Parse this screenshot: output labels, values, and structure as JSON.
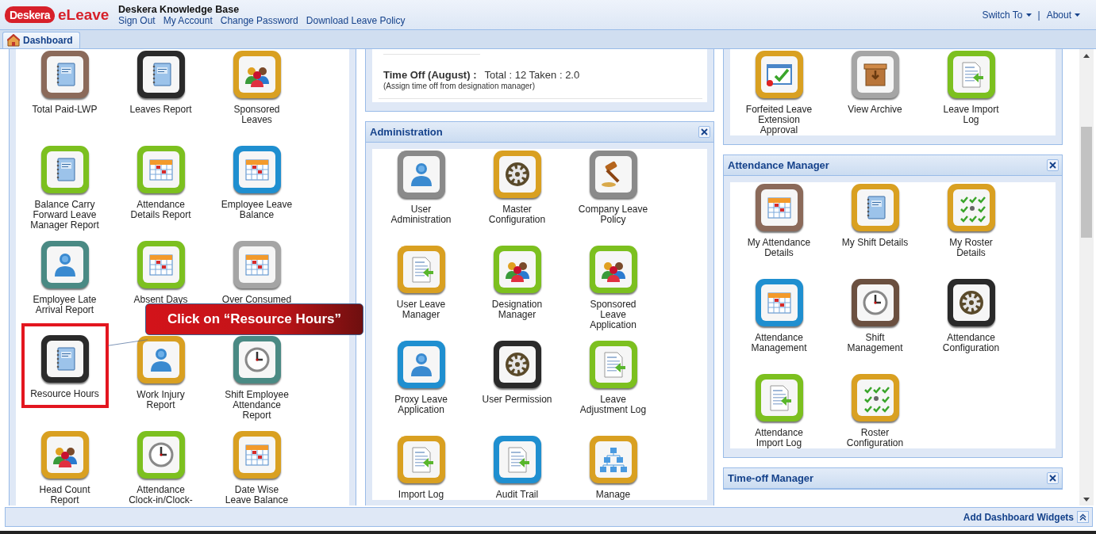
{
  "header": {
    "logo": {
      "mark": "Deskera",
      "product": "eLeave"
    },
    "site_title": "Deskera Knowledge Base",
    "links": [
      "Sign Out",
      "My Account",
      "Change Password",
      "Download Leave Policy"
    ],
    "menus": [
      {
        "label": "Switch To"
      },
      {
        "label": "About"
      }
    ],
    "separator": "|"
  },
  "tabs": [
    {
      "label": "Dashboard",
      "selected": true
    }
  ],
  "columns": [
    {
      "panels": [
        {
          "items": [
            {
              "label": "Total Paid-LWP",
              "kind": "notebook",
              "color": "#8b6a5a",
              "highlighted": false
            },
            {
              "label": "Leaves Report",
              "kind": "notebook",
              "color": "#2a2a2a",
              "highlighted": false
            },
            {
              "label": "Sponsored\nLeaves",
              "kind": "people",
              "color": "#d9a021",
              "highlighted": false
            },
            {
              "label": "Balance Carry\nForward Leave\nManager Report",
              "kind": "notebook",
              "color": "#7cc01f",
              "highlighted": false
            },
            {
              "label": "Attendance\nDetails Report",
              "kind": "calendar",
              "color": "#7cc01f",
              "highlighted": false
            },
            {
              "label": "Employee Leave\nBalance",
              "kind": "calendar",
              "color": "#1f8fd0",
              "highlighted": false
            },
            {
              "label": "Employee Late\nArrival Report",
              "kind": "person",
              "color": "#4a8a84",
              "highlighted": false
            },
            {
              "label": "Absent Days",
              "kind": "calendar",
              "color": "#7cc01f",
              "highlighted": false
            },
            {
              "label": "Over Consumed",
              "kind": "calendar",
              "color": "#a5a5a5",
              "highlighted": false
            },
            {
              "label": "Resource Hours",
              "kind": "notebook",
              "color": "#2a2a2a",
              "highlighted": true
            },
            {
              "label": "Work Injury\nReport",
              "kind": "person",
              "color": "#d9a021",
              "highlighted": false
            },
            {
              "label": "Shift Employee\nAttendance\nReport",
              "kind": "clock",
              "color": "#4a8a84",
              "highlighted": false
            },
            {
              "label": "Head Count\nReport",
              "kind": "people",
              "color": "#d9a021",
              "highlighted": false
            },
            {
              "label": "Attendance\nClock-in/Clock-",
              "kind": "clock",
              "color": "#7cc01f",
              "highlighted": false
            },
            {
              "label": "Date Wise\nLeave Balance",
              "kind": "calendar",
              "color": "#d9a021",
              "highlighted": false
            }
          ]
        }
      ]
    },
    {
      "panels": [
        {
          "info": {
            "heading": "Time Off (August) :",
            "value": "Total : 12 Taken : 2.0",
            "note": "(Assign time off from designation manager)"
          }
        },
        {
          "title": "Administration",
          "closable": true,
          "items": [
            {
              "label": "User\nAdministration",
              "kind": "person",
              "color": "#8a8a8a",
              "highlighted": false
            },
            {
              "label": "Master\nConfiguration",
              "kind": "gear",
              "color": "#d9a021",
              "highlighted": false
            },
            {
              "label": "Company Leave\nPolicy",
              "kind": "gavel",
              "color": "#8a8a8a",
              "highlighted": false
            },
            {
              "label": "User Leave\nManager",
              "kind": "document",
              "color": "#d9a021",
              "highlighted": false
            },
            {
              "label": "Designation\nManager",
              "kind": "people",
              "color": "#7cc01f",
              "highlighted": false
            },
            {
              "label": "Sponsored\nLeave\nApplication",
              "kind": "people",
              "color": "#7cc01f",
              "highlighted": false
            },
            {
              "label": "Proxy Leave\nApplication",
              "kind": "person",
              "color": "#1f8fd0",
              "highlighted": false
            },
            {
              "label": "User Permission",
              "kind": "gear",
              "color": "#2a2a2a",
              "highlighted": false
            },
            {
              "label": "Leave\nAdjustment Log",
              "kind": "document",
              "color": "#7cc01f",
              "highlighted": false
            },
            {
              "label": "Import Log",
              "kind": "document",
              "color": "#d9a021",
              "highlighted": false
            },
            {
              "label": "Audit Trail",
              "kind": "document",
              "color": "#1f8fd0",
              "highlighted": false
            },
            {
              "label": "Manage",
              "kind": "hierarchy",
              "color": "#d9a021",
              "highlighted": false
            }
          ]
        }
      ]
    },
    {
      "panels": [
        {
          "items": [
            {
              "label": "Forfeited Leave\nExtension\nApproval",
              "kind": "window",
              "color": "#d9a021",
              "highlighted": false
            },
            {
              "label": "View Archive",
              "kind": "box",
              "color": "#a5a5a5",
              "highlighted": false
            },
            {
              "label": "Leave Import\nLog",
              "kind": "document",
              "color": "#7cc01f",
              "highlighted": false
            }
          ]
        },
        {
          "title": "Attendance Manager",
          "closable": true,
          "items": [
            {
              "label": "My Attendance\nDetails",
              "kind": "calendar",
              "color": "#8b6a5a",
              "highlighted": false
            },
            {
              "label": "My Shift Details",
              "kind": "notebook",
              "color": "#d9a021",
              "highlighted": false
            },
            {
              "label": "My Roster\nDetails",
              "kind": "checks",
              "color": "#d9a021",
              "highlighted": false
            },
            {
              "label": "Attendance\nManagement",
              "kind": "calendar",
              "color": "#1f8fd0",
              "highlighted": false
            },
            {
              "label": "Shift\nManagement",
              "kind": "clock",
              "color": "#6b5040",
              "highlighted": false
            },
            {
              "label": "Attendance\nConfiguration",
              "kind": "gear",
              "color": "#2a2a2a",
              "highlighted": false
            },
            {
              "label": "Attendance\nImport Log",
              "kind": "document",
              "color": "#7cc01f",
              "highlighted": false
            },
            {
              "label": "Roster\nConfiguration",
              "kind": "checks",
              "color": "#d9a021",
              "highlighted": false
            }
          ]
        },
        {
          "title": "Time-off Manager",
          "closable": true
        }
      ]
    }
  ],
  "callout": {
    "text": "Click on “Resource Hours”"
  },
  "bottom_bar": {
    "label": "Add Dashboard Widgets"
  }
}
